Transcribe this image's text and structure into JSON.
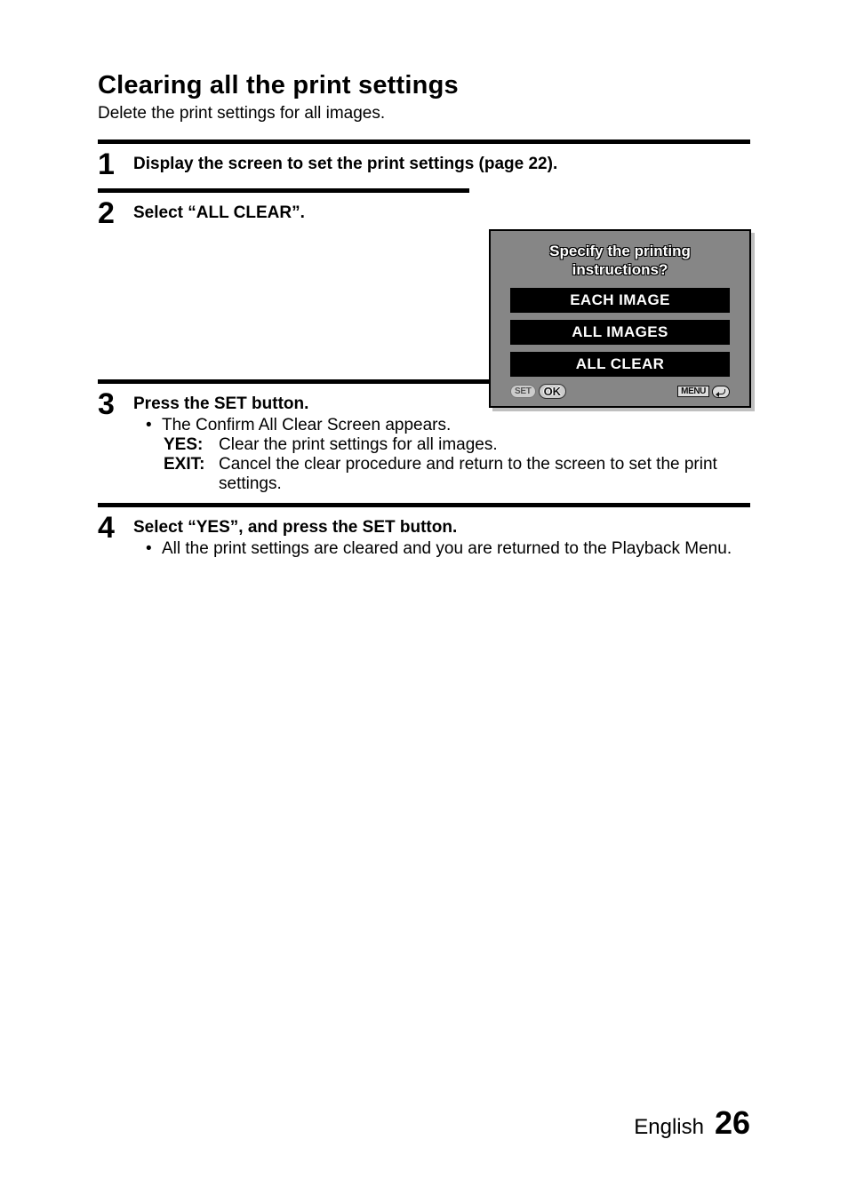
{
  "heading": "Clearing all the print settings",
  "subtitle": "Delete the print settings for all images.",
  "steps": {
    "s1": {
      "num": "1",
      "title": "Display the screen to set the print settings (page 22)."
    },
    "s2": {
      "num": "2",
      "title": "Select “ALL CLEAR”."
    },
    "s3": {
      "num": "3",
      "title": "Press the SET button.",
      "bullet1": "The Confirm All Clear Screen appears.",
      "yes_label": "YES:",
      "yes_text": "Clear the print settings for all images.",
      "exit_label": "EXIT:",
      "exit_text": "Cancel the clear procedure and return to the screen to set the print settings."
    },
    "s4": {
      "num": "4",
      "title": "Select “YES”, and press the SET button.",
      "bullet1": "All the print settings are cleared and you are returned to the Playback Menu."
    }
  },
  "device": {
    "title_l1": "Specify the printing",
    "title_l2": "instructions?",
    "items": [
      "EACH IMAGE",
      "ALL IMAGES",
      "ALL CLEAR"
    ],
    "set": "SET",
    "ok": "OK",
    "menu": "MENU"
  },
  "footer": {
    "language": "English",
    "page": "26"
  }
}
